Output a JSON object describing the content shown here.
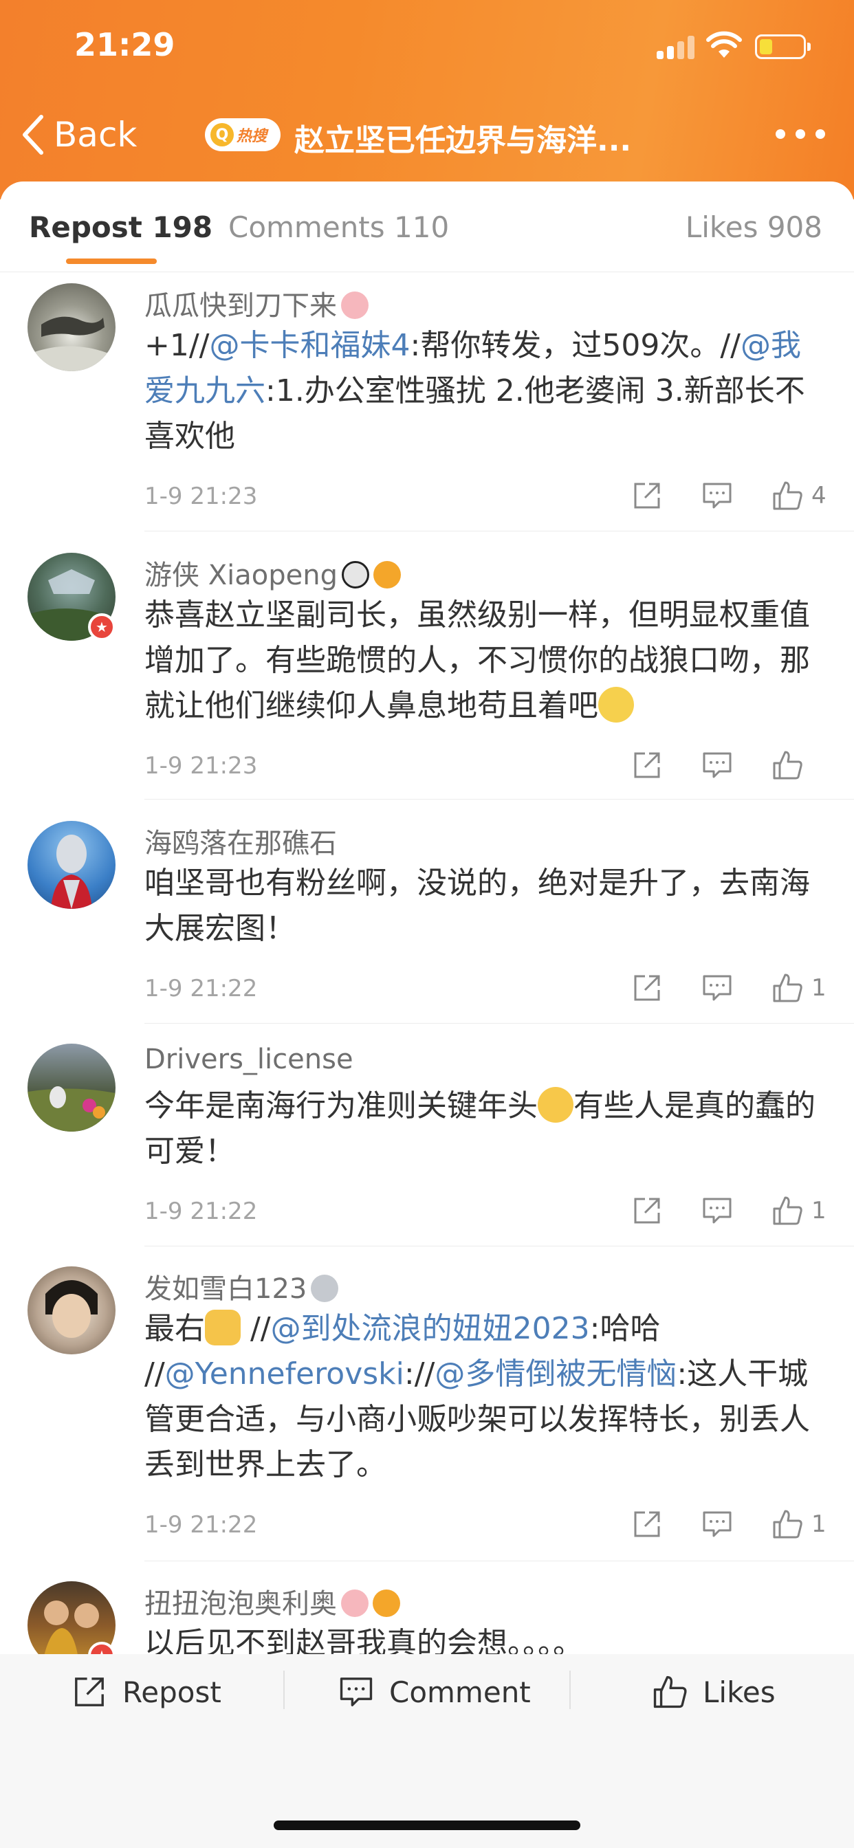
{
  "status_bar": {
    "time": "21:29"
  },
  "nav": {
    "back_label": "Back",
    "search_badge": "热搜",
    "title": "赵立坚已任边界与海洋..."
  },
  "tabs": {
    "repost": "Repost 198",
    "comments": "Comments 110",
    "likes": "Likes 908"
  },
  "comments": [
    {
      "username": "瓜瓜快到刀下来",
      "body_parts": [
        "+1//",
        "@卡卡和福妹4",
        ":帮你转发，过509次。//",
        "@我爱九九六",
        ":1.办公室性骚扰 2.他老婆闹 3.新部长不喜欢他"
      ],
      "date": "1-9 21:23",
      "likes": "4"
    },
    {
      "username": "游侠 Xiaopeng",
      "body_parts": [
        "恭喜赵立坚副司长，虽然级别一样，但明显权重值增加了。有些跪惯的人，不习惯你的战狼口吻，那就让他们继续仰人鼻息地苟且着吧"
      ],
      "date": "1-9 21:23",
      "likes": ""
    },
    {
      "username": "海鸥落在那礁石",
      "body_parts": [
        "咱坚哥也有粉丝啊，没说的，绝对是升了，去南海大展宏图！"
      ],
      "date": "1-9 21:22",
      "likes": "1"
    },
    {
      "username": "Drivers_license",
      "body_parts": [
        "今年是南海行为准则关键年头",
        "有些人是真的蠢的可爱！"
      ],
      "date": "1-9 21:22",
      "likes": "1"
    },
    {
      "username": "发如雪白123",
      "body_parts": [
        "最右",
        " //",
        "@到处流浪的妞妞2023",
        ":哈哈 //",
        "@Yenneferovski",
        "://",
        "@多情倒被无情恼",
        ":这人干城管更合适，与小商小贩吵架可以发挥特长，别丢人丢到世界上去了。"
      ],
      "date": "1-9 21:22",
      "likes": "1"
    },
    {
      "username": "扭扭泡泡奥利奥",
      "body_parts": [
        "以后见不到赵哥我真的会想。。。。"
      ],
      "date": "",
      "likes": ""
    }
  ],
  "bottom_bar": {
    "repost": "Repost",
    "comment": "Comment",
    "likes": "Likes"
  },
  "colors": {
    "header_orange": "#f58a2c",
    "mention_blue": "#4d7eb8",
    "badge_red": "#e8453c"
  }
}
